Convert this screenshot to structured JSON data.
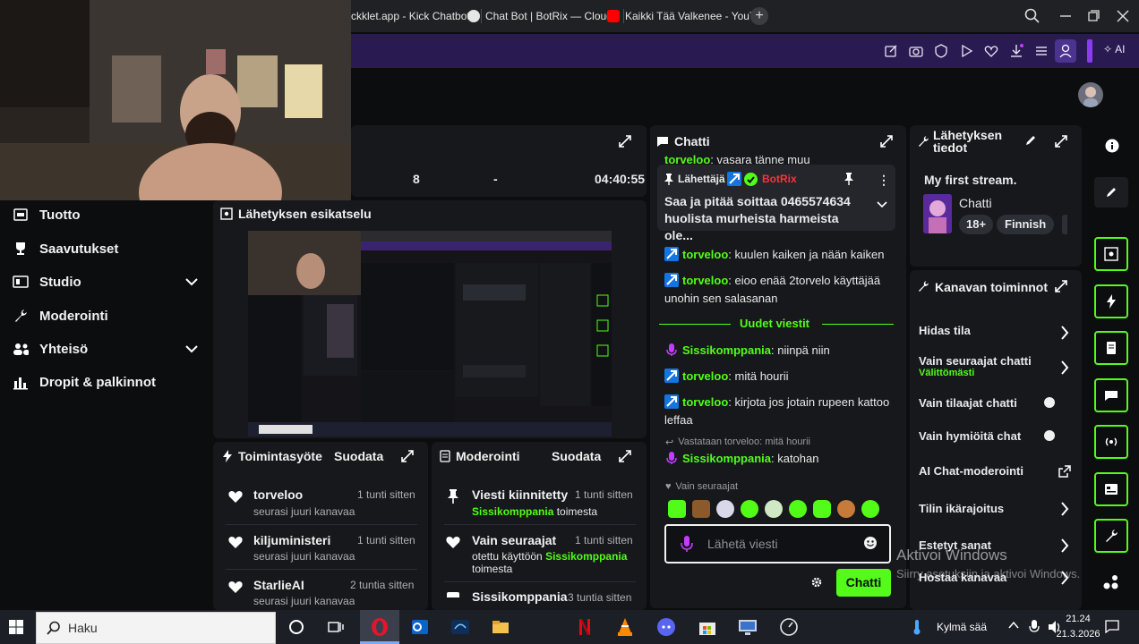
{
  "browser": {
    "tabs": [
      {
        "label": "ckklet.app - Kick Chatbot"
      },
      {
        "label": "Chat Bot | BotRix — Cloud"
      },
      {
        "label": "Kaikki Tää Valkenee - YouT"
      }
    ],
    "new_tab": "+",
    "ai_label": "AI"
  },
  "stream_bar": {
    "value1": "8",
    "value2": "-",
    "uptime": "04:40:55"
  },
  "sidebar": {
    "items": [
      {
        "label": "Tuotto",
        "icon": "chart-icon"
      },
      {
        "label": "Saavutukset",
        "icon": "trophy-icon"
      },
      {
        "label": "Studio",
        "icon": "studio-icon",
        "expandable": true
      },
      {
        "label": "Moderointi",
        "icon": "wrench-icon"
      },
      {
        "label": "Yhteisö",
        "icon": "people-icon",
        "expandable": true
      },
      {
        "label": "Dropit & palkinnot",
        "icon": "gift-icon"
      }
    ]
  },
  "preview": {
    "title": "Lähetyksen esikatselu"
  },
  "activity": {
    "title": "Toimintasyöte",
    "filter": "Suodata",
    "items": [
      {
        "user": "torveloo",
        "sub": "seurasi juuri kanavaa",
        "time": "1 tunti sitten"
      },
      {
        "user": "kiljuministeri",
        "sub": "seurasi juuri kanavaa",
        "time": "1 tunti sitten"
      },
      {
        "user": "StarlieAI",
        "sub": "seurasi juuri kanavaa",
        "time": "2 tuntia sitten"
      }
    ]
  },
  "moderation": {
    "title": "Moderointi",
    "filter": "Suodata",
    "items": [
      {
        "title": "Viesti kiinnitetty",
        "time": "1 tunti sitten",
        "pre": "",
        "user": "Sissikomppania",
        "post": "toimesta"
      },
      {
        "title": "Vain seuraajat",
        "time": "1 tunti sitten",
        "pre": "otettu käyttöön",
        "user": "Sissikomppania",
        "post": "toimesta"
      },
      {
        "title": "Sissikomppania",
        "time": "3 tuntia sitten",
        "pre": "",
        "user": "",
        "post": ""
      }
    ]
  },
  "chat": {
    "title": "Chatti",
    "top_line": {
      "user": "torveloo",
      "text": ": vasara tänne muu"
    },
    "pinned": {
      "label": "Lähettäjä",
      "user": "BotRix",
      "text": "Saa ja pitää soittaa 0465574634 huolista murheista harmeista ole..."
    },
    "messages": [
      {
        "user": "torveloo",
        "text": ": kuulen kaiken ja nään kaiken",
        "badge": "bot"
      },
      {
        "user": "torveloo",
        "text": ": eioo enää 2torvelo käyttäjää unohin sen salasanan",
        "badge": "bot"
      }
    ],
    "new_messages": "Uudet viestit",
    "new": [
      {
        "user": "Sissikomppania",
        "text": ": niinpä niin",
        "badge": "mic",
        "color": "#53fc18"
      },
      {
        "user": "torveloo",
        "text": ": mitä hourii",
        "badge": "bot",
        "color": "#53fc18"
      },
      {
        "user": "torveloo",
        "text": ": kirjota jos jotain rupeen kattoo leffaa",
        "badge": "bot",
        "color": "#53fc18"
      }
    ],
    "reply_to": "Vastataan torveloo: mitä hourii",
    "reply": {
      "user": "Sissikomppania",
      "text": ": katohan"
    },
    "followers_only": "Vain seuraajat",
    "input_placeholder": "Lähetä viesti",
    "send": "Chatti"
  },
  "stream_info": {
    "title": "Lähetyksen tiedot",
    "stream_title": "My first stream.",
    "category": "Chatti",
    "tags": [
      "18+",
      "Finnish"
    ]
  },
  "channel_actions": {
    "title": "Kanavan toiminnot",
    "items": [
      {
        "label": "Hidas tila",
        "sub": "",
        "control": "chevron"
      },
      {
        "label": "Vain seuraajat chatti",
        "sub": "Välittömästi",
        "control": "chevron"
      },
      {
        "label": "Vain tilaajat chatti",
        "sub": "",
        "control": "toggle"
      },
      {
        "label": "Vain hymiöitä chat",
        "sub": "",
        "control": "toggle"
      },
      {
        "label": "AI Chat-moderointi",
        "sub": "",
        "control": "external"
      },
      {
        "label": "Tilin ikärajoitus",
        "sub": "",
        "control": "chevron"
      },
      {
        "label": "Estetyt sanat",
        "sub": "",
        "control": "chevron"
      },
      {
        "label": "Hostaa kanavaa",
        "sub": "",
        "control": "chevron"
      }
    ]
  },
  "watermark": {
    "line1": "Aktivoi Windows",
    "line2": "Siirry asetuksiin ja aktivoi Windows."
  },
  "taskbar": {
    "search_placeholder": "Haku",
    "weather": "Kylmä sää",
    "time": "21.24",
    "date": "21.3.2026"
  },
  "colors": {
    "accent": "#53fc18",
    "toolbar": "#2a1a52",
    "panel": "#16181c",
    "mic_badge": "#b83bde",
    "bot_badge": "#1475e1"
  }
}
